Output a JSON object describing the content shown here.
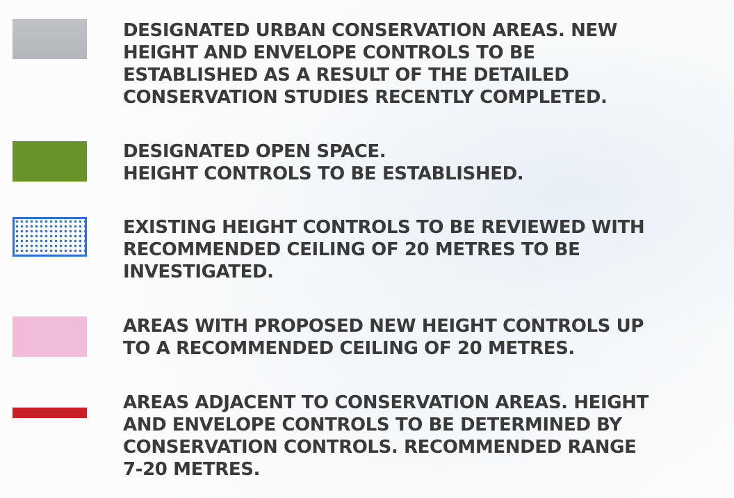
{
  "legend": {
    "items": [
      {
        "swatch": "grey",
        "color": "#b8babf",
        "text": "DESIGNATED URBAN CONSERVATION AREAS. NEW\nHEIGHT AND ENVELOPE CONTROLS TO BE\nESTABLISHED AS A RESULT OF THE DETAILED\nCONSERVATION STUDIES RECENTLY COMPLETED."
      },
      {
        "swatch": "green",
        "color": "#6a922b",
        "text": "DESIGNATED OPEN SPACE.\nHEIGHT CONTROLS TO BE ESTABLISHED."
      },
      {
        "swatch": "blue-dotted",
        "color": "#2f6fd6",
        "text": "EXISTING HEIGHT CONTROLS TO BE REVIEWED WITH\nRECOMMENDED CEILING OF 20 METRES TO BE\nINVESTIGATED."
      },
      {
        "swatch": "pink",
        "color": "#f0bcd9",
        "text": "AREAS WITH PROPOSED NEW HEIGHT CONTROLS UP\nTO A RECOMMENDED CEILING OF 20 METRES."
      },
      {
        "swatch": "red-line",
        "color": "#c81f24",
        "text": "AREAS ADJACENT TO CONSERVATION AREAS. HEIGHT\nAND ENVELOPE CONTROLS TO BE DETERMINED BY\nCONSERVATION CONTROLS. RECOMMENDED RANGE\n7-20 METRES."
      }
    ]
  }
}
